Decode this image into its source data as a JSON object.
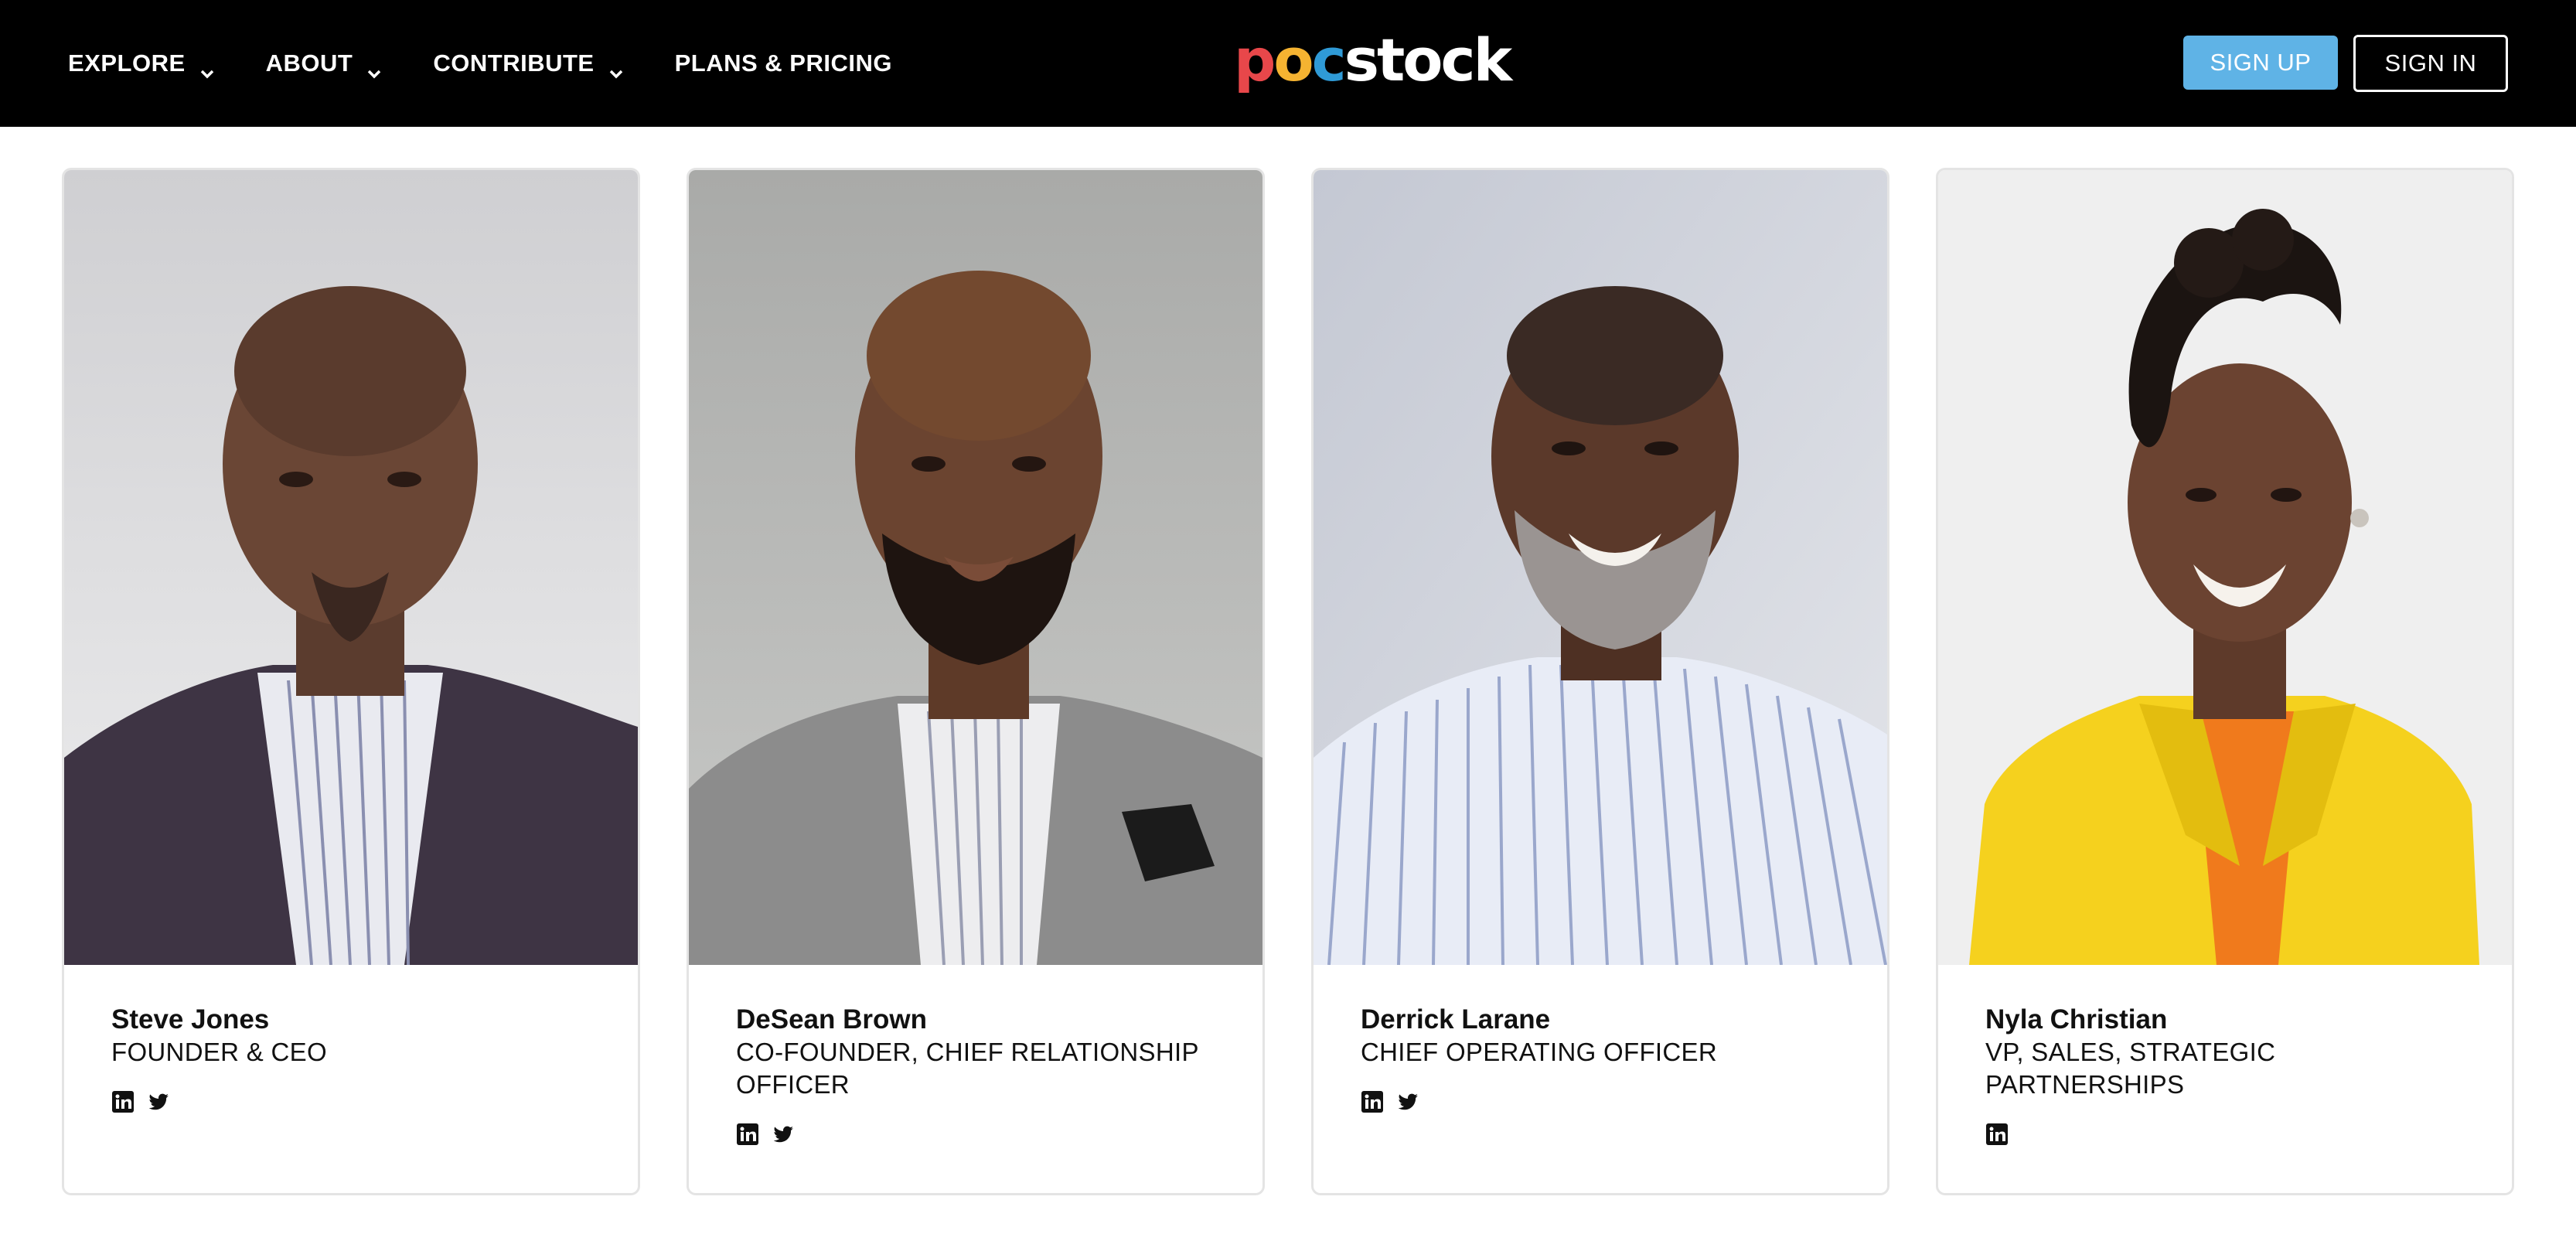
{
  "nav": {
    "items": [
      {
        "label": "EXPLORE",
        "has_dropdown": true
      },
      {
        "label": "ABOUT",
        "has_dropdown": true
      },
      {
        "label": "CONTRIBUTE",
        "has_dropdown": true
      },
      {
        "label": "PLANS & PRICING",
        "has_dropdown": false
      }
    ],
    "signup_label": "SIGN UP",
    "signin_label": "SIGN IN"
  },
  "logo": {
    "letters": [
      {
        "char": "p",
        "color": "#e8474a"
      },
      {
        "char": "o",
        "color": "#f5b331"
      },
      {
        "char": "c",
        "color": "#2f9ad6"
      },
      {
        "char": "s",
        "color": "#ffffff"
      },
      {
        "char": "t",
        "color": "#ffffff"
      },
      {
        "char": "o",
        "color": "#ffffff"
      },
      {
        "char": "c",
        "color": "#ffffff"
      },
      {
        "char": "k",
        "color": "#ffffff"
      }
    ]
  },
  "team": [
    {
      "name": "Steve Jones",
      "role_lines": [
        "FOUNDER & CEO"
      ],
      "socials": [
        "linkedin-icon",
        "twitter-icon"
      ]
    },
    {
      "name": "DeSean Brown",
      "role_lines": [
        "CO-FOUNDER, CHIEF RELATIONSHIP",
        "OFFICER"
      ],
      "socials": [
        "linkedin-icon",
        "twitter-icon"
      ]
    },
    {
      "name": "Derrick Larane",
      "role_lines": [
        "CHIEF OPERATING OFFICER"
      ],
      "socials": [
        "linkedin-icon",
        "twitter-icon"
      ]
    },
    {
      "name": "Nyla Christian",
      "role_lines": [
        "VP, SALES, STRATEGIC",
        "PARTNERSHIPS"
      ],
      "socials": [
        "linkedin-icon"
      ]
    }
  ],
  "colors": {
    "topbar_bg": "#000000",
    "signup_bg": "#5fb3e6",
    "card_border": "#e4e4e4"
  }
}
